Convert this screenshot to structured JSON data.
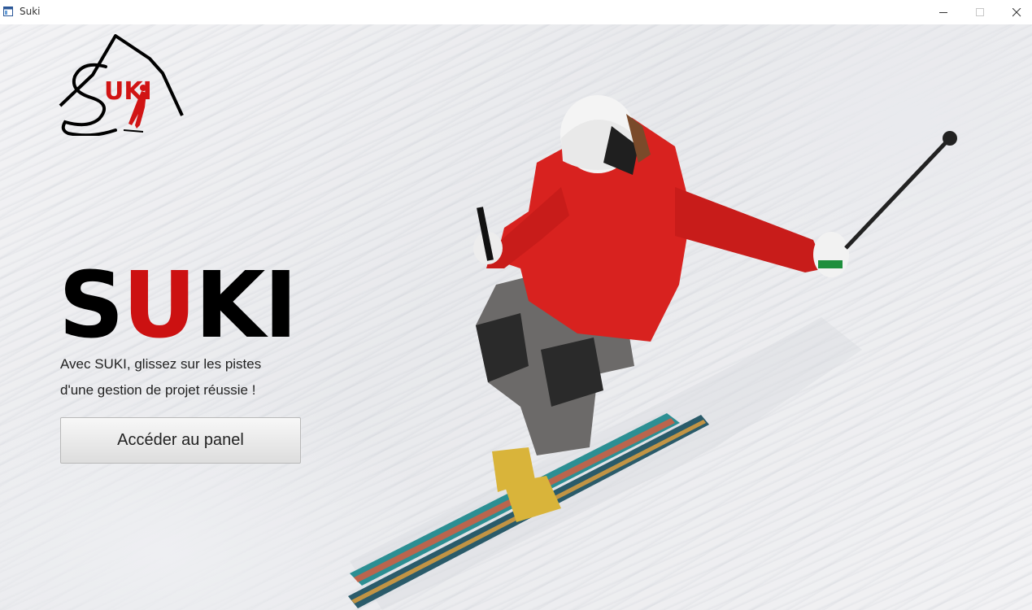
{
  "window": {
    "title": "Suki",
    "icon": "app-window-icon",
    "controls": [
      "minimize-icon",
      "maximize-icon",
      "close-icon"
    ]
  },
  "logo": {
    "text_s": "S",
    "text_uki": "UKI"
  },
  "hero": {
    "brand_s": "S",
    "brand_u": "U",
    "brand_ki": "KI",
    "tagline_line1": "Avec SUKI, glissez sur les pistes",
    "tagline_line2": "d'une gestion de projet réussie !",
    "button_label": "Accéder au panel"
  },
  "colors": {
    "accent_red": "#cc1111",
    "jacket_red": "#d8221f",
    "text": "#222222"
  }
}
